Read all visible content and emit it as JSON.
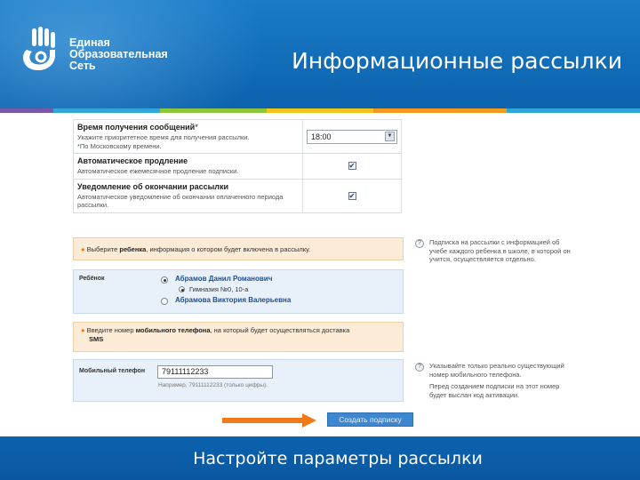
{
  "header": {
    "logo_lines": [
      "Единая",
      "Образовательная",
      "Сеть"
    ],
    "title": "Информационные рассылки"
  },
  "colors": {
    "header_blue": "#0c62ad",
    "strip": [
      "#7b57a8",
      "#2fa8d8",
      "#8cc63f",
      "#f2c31c",
      "#f39a1e",
      "#2fa8d8"
    ],
    "orange_arrow": "#f07a1a",
    "button_blue": "#3d86d0"
  },
  "settings": {
    "time": {
      "title": "Время получения сообщений",
      "required_mark": "*",
      "desc1": "Укажите приоритетное время для получения рассылки.",
      "desc2": "*По Московскому времени.",
      "value": "18:00"
    },
    "auto_renewal": {
      "title": "Автоматическое продление",
      "desc": "Автоматическое ежемесячное продление подписки.",
      "checked": true
    },
    "end_notice": {
      "title": "Уведомление об окончании рассылки",
      "desc": "Автоматическое уведомление об окончании оплаченного периода рассылки.",
      "checked": true
    }
  },
  "child_note": {
    "pre": "Выберите ",
    "bold": "ребенка",
    "post": ", информация о котором будет включена в рассылку."
  },
  "child_help": "Подписка на рассылки с информацией об учебе каждого ребенка в школе, в которой он учится, осуществляется отдельно.",
  "children": {
    "label": "Ребёнок",
    "items": [
      {
        "name": "Абрамов Данил Романович",
        "selected": true,
        "school": "Гимназия №0, 10-а"
      },
      {
        "name": "Абрамова Виктория Валерьевна",
        "selected": false
      }
    ]
  },
  "phone_note": {
    "pre": "Введите номер ",
    "bold": "мобильного телефона",
    "post": ", на который будет осуществляться доставка",
    "line2": "SMS"
  },
  "phone": {
    "label": "Мобильный телефон",
    "value": "79111112233",
    "hint": "Например, 79111112233 (только цифры)."
  },
  "phone_help": {
    "p1": "Указывайте только реально существующий номер мобильного телефона.",
    "p2": "Перед созданием подписки на этот номер будет выслан код активации."
  },
  "help_icon": "?",
  "submit": "Создать подписку",
  "footer": "Настройте параметры рассылки"
}
